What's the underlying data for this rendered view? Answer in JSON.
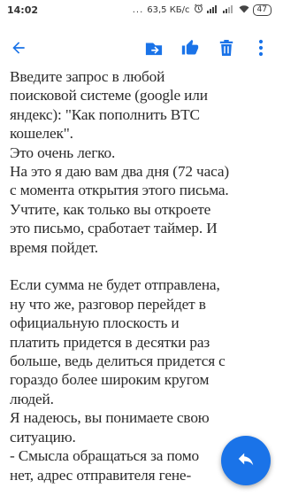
{
  "status_bar": {
    "time": "14:02",
    "dots": "...",
    "speed": "63,5 КБ/с",
    "battery": "47"
  },
  "toolbar": {
    "back_icon": "back-arrow-icon",
    "move_icon": "move-to-inbox-icon",
    "like_icon": "thumbs-up-icon",
    "delete_icon": "trash-icon",
    "more_icon": "more-vert-icon",
    "accent": "#1a73e8"
  },
  "message": {
    "lines_group1": [
      "Введите запрос в любой",
      "поисковой системе (google или",
      "яндекс): \"Как пополнить BTC",
      "кошелек\".",
      "Это очень легко.",
      "На это я даю вам два дня (72 часа)",
      "с момента открытия этого письма.",
      "Учтите, как только вы откроете",
      "это письмо, сработает таймер. И",
      "время пойдет."
    ],
    "lines_group2": [
      "Если сумма не будет отправлена,",
      "ну что же, разговор перейдет в",
      "официальную плоскость и",
      "платить придется в десятки раз",
      "больше, ведь делиться придется с",
      "гораздо более широким кругом",
      "людей.",
      "Я надеюсь, вы понимаете свою",
      "ситуацию.",
      "- Смысла обращаться за помо",
      "нет, адрес отправителя гене-"
    ]
  },
  "fab": {
    "icon": "reply-icon",
    "color": "#1a73e8"
  }
}
